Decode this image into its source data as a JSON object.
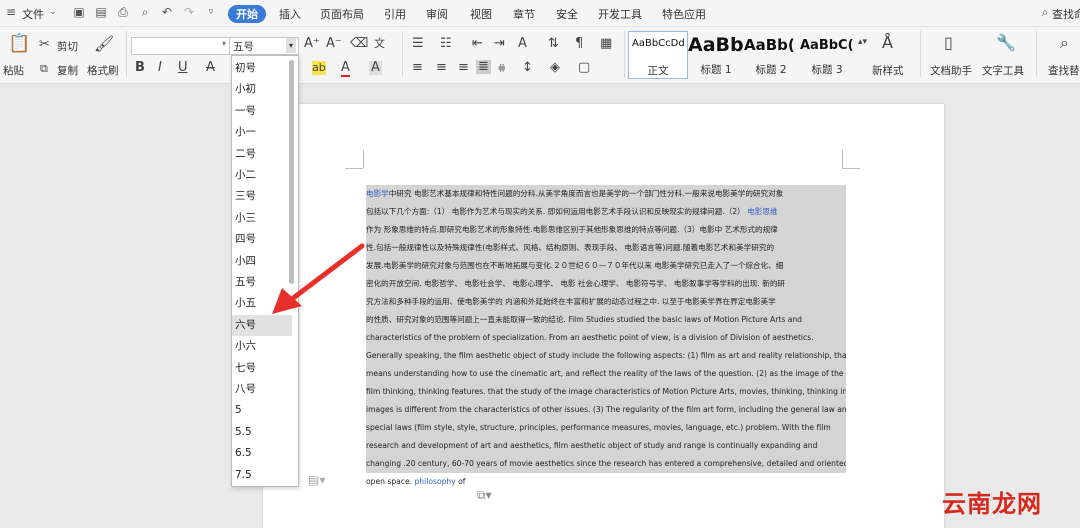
{
  "menubar": {
    "menu_label": "文件",
    "tabs": [
      {
        "label": "开始",
        "active": true
      },
      {
        "label": "插入"
      },
      {
        "label": "页面布局"
      },
      {
        "label": "引用"
      },
      {
        "label": "审阅"
      },
      {
        "label": "视图"
      },
      {
        "label": "章节"
      },
      {
        "label": "安全"
      },
      {
        "label": "开发工具"
      },
      {
        "label": "特色应用"
      }
    ],
    "search_label": "查找命"
  },
  "ribbon": {
    "paste": "粘贴",
    "cut": "剪切",
    "copy": "复制",
    "format_painter": "格式刷",
    "font_name": "",
    "font_size": "五号",
    "styles": [
      {
        "sample": "AaBbCcDd",
        "name": "正文"
      },
      {
        "sample": "AaBb",
        "name": "标题 1"
      },
      {
        "sample": "AaBb(",
        "name": "标题 2"
      },
      {
        "sample": "AaBbC(",
        "name": "标题 3"
      }
    ],
    "new_style": "新样式",
    "doc_helper": "文档助手",
    "text_tools": "文字工具",
    "find_replace": "查找替"
  },
  "font_size_dropdown": {
    "options": [
      "初号",
      "小初",
      "一号",
      "小一",
      "二号",
      "小二",
      "三号",
      "小三",
      "四号",
      "小四",
      "五号",
      "小五",
      "六号",
      "小六",
      "七号",
      "八号",
      "5",
      "5.5",
      "6.5",
      "7.5"
    ],
    "highlighted": "六号"
  },
  "document": {
    "lines": [
      {
        "link": "电影学",
        "text": "中研究  电影艺术基本规律和特性问题的分科.从美学角度而言也是美学的一个部门性分科.一般来说电影美学的研究对象"
      },
      {
        "text": "包括以下几个方面:（1） 电影作为艺术与现实的关系. 即如何运用电影艺术手段认识和反映现实的规律问题.（2） ",
        "link2": "电影思维"
      },
      {
        "text": "作为 形象思维的特点.即研究电影艺术的形象特性.电影思维区别于其他形象思维的特点等问题.（3）电影中 艺术形式的规律"
      },
      {
        "text": "性.包括一般规律性以及特殊规律性(电影样式、风格、结构原则、表现手段、  电影语言等)问题.随着电影艺术和美学研究的"
      },
      {
        "text": "发展.电影美学的研究对象与范围也在不断地拓展与变化.２０世纪６０—７０年代以来 电影美学研究已走入了一个综合化、细"
      },
      {
        "text": "密化的开放空间. 电影哲学、 电影社会学、 电影心理学、 电影 社会心理学、 电影符号学、 电影叙事学等学科的出现. 新的研"
      },
      {
        "text": "究方法和多种手段的运用、使电影美学的 内涵和外延始终在丰富和扩展的动态过程之中. 以至于电影美学界在界定电影美学"
      },
      {
        "text": "的性质、研究对象的范围等问题上一直未能取得一致的结论. Film Studies studied the basic laws of Motion Picture Arts and"
      },
      {
        "text": "characteristics of the problem of specialization. From an aesthetic point of view, is a division of Division of aesthetics."
      },
      {
        "text": "Generally speaking, the film aesthetic object of study include the following aspects: (1) film as art and reality relationship, that"
      },
      {
        "text": "means understanding how to use the cinematic art, and reflect the reality of the laws of the question. (2) as the image of the"
      },
      {
        "text": "film thinking, thinking features. that the study of the image characteristics of Motion Picture Arts, movies, thinking, thinking in"
      },
      {
        "text": "images is different from the characteristics of other issues. (3) The regularity of the film art form, including the general law and"
      },
      {
        "text": "special laws (film style, style, structure, principles, performance measures, movies, language, etc.) problem. With the film"
      },
      {
        "text": "research and development of art and aesthetics, film aesthetic object of study and range is continually expanding and"
      },
      {
        "text": "changing .20 century, 60-70 years of movie aesthetics since the research has entered a comprehensive, detailed and oriented"
      },
      {
        "text": "open space. ",
        "link2": "philosophy",
        "tail": " of"
      }
    ]
  },
  "watermark": "云南龙网",
  "colors": {
    "accent": "#3b7bd8",
    "arrow": "#e8302a",
    "selection": "#d4d4d4",
    "link": "#2f5fbf"
  }
}
